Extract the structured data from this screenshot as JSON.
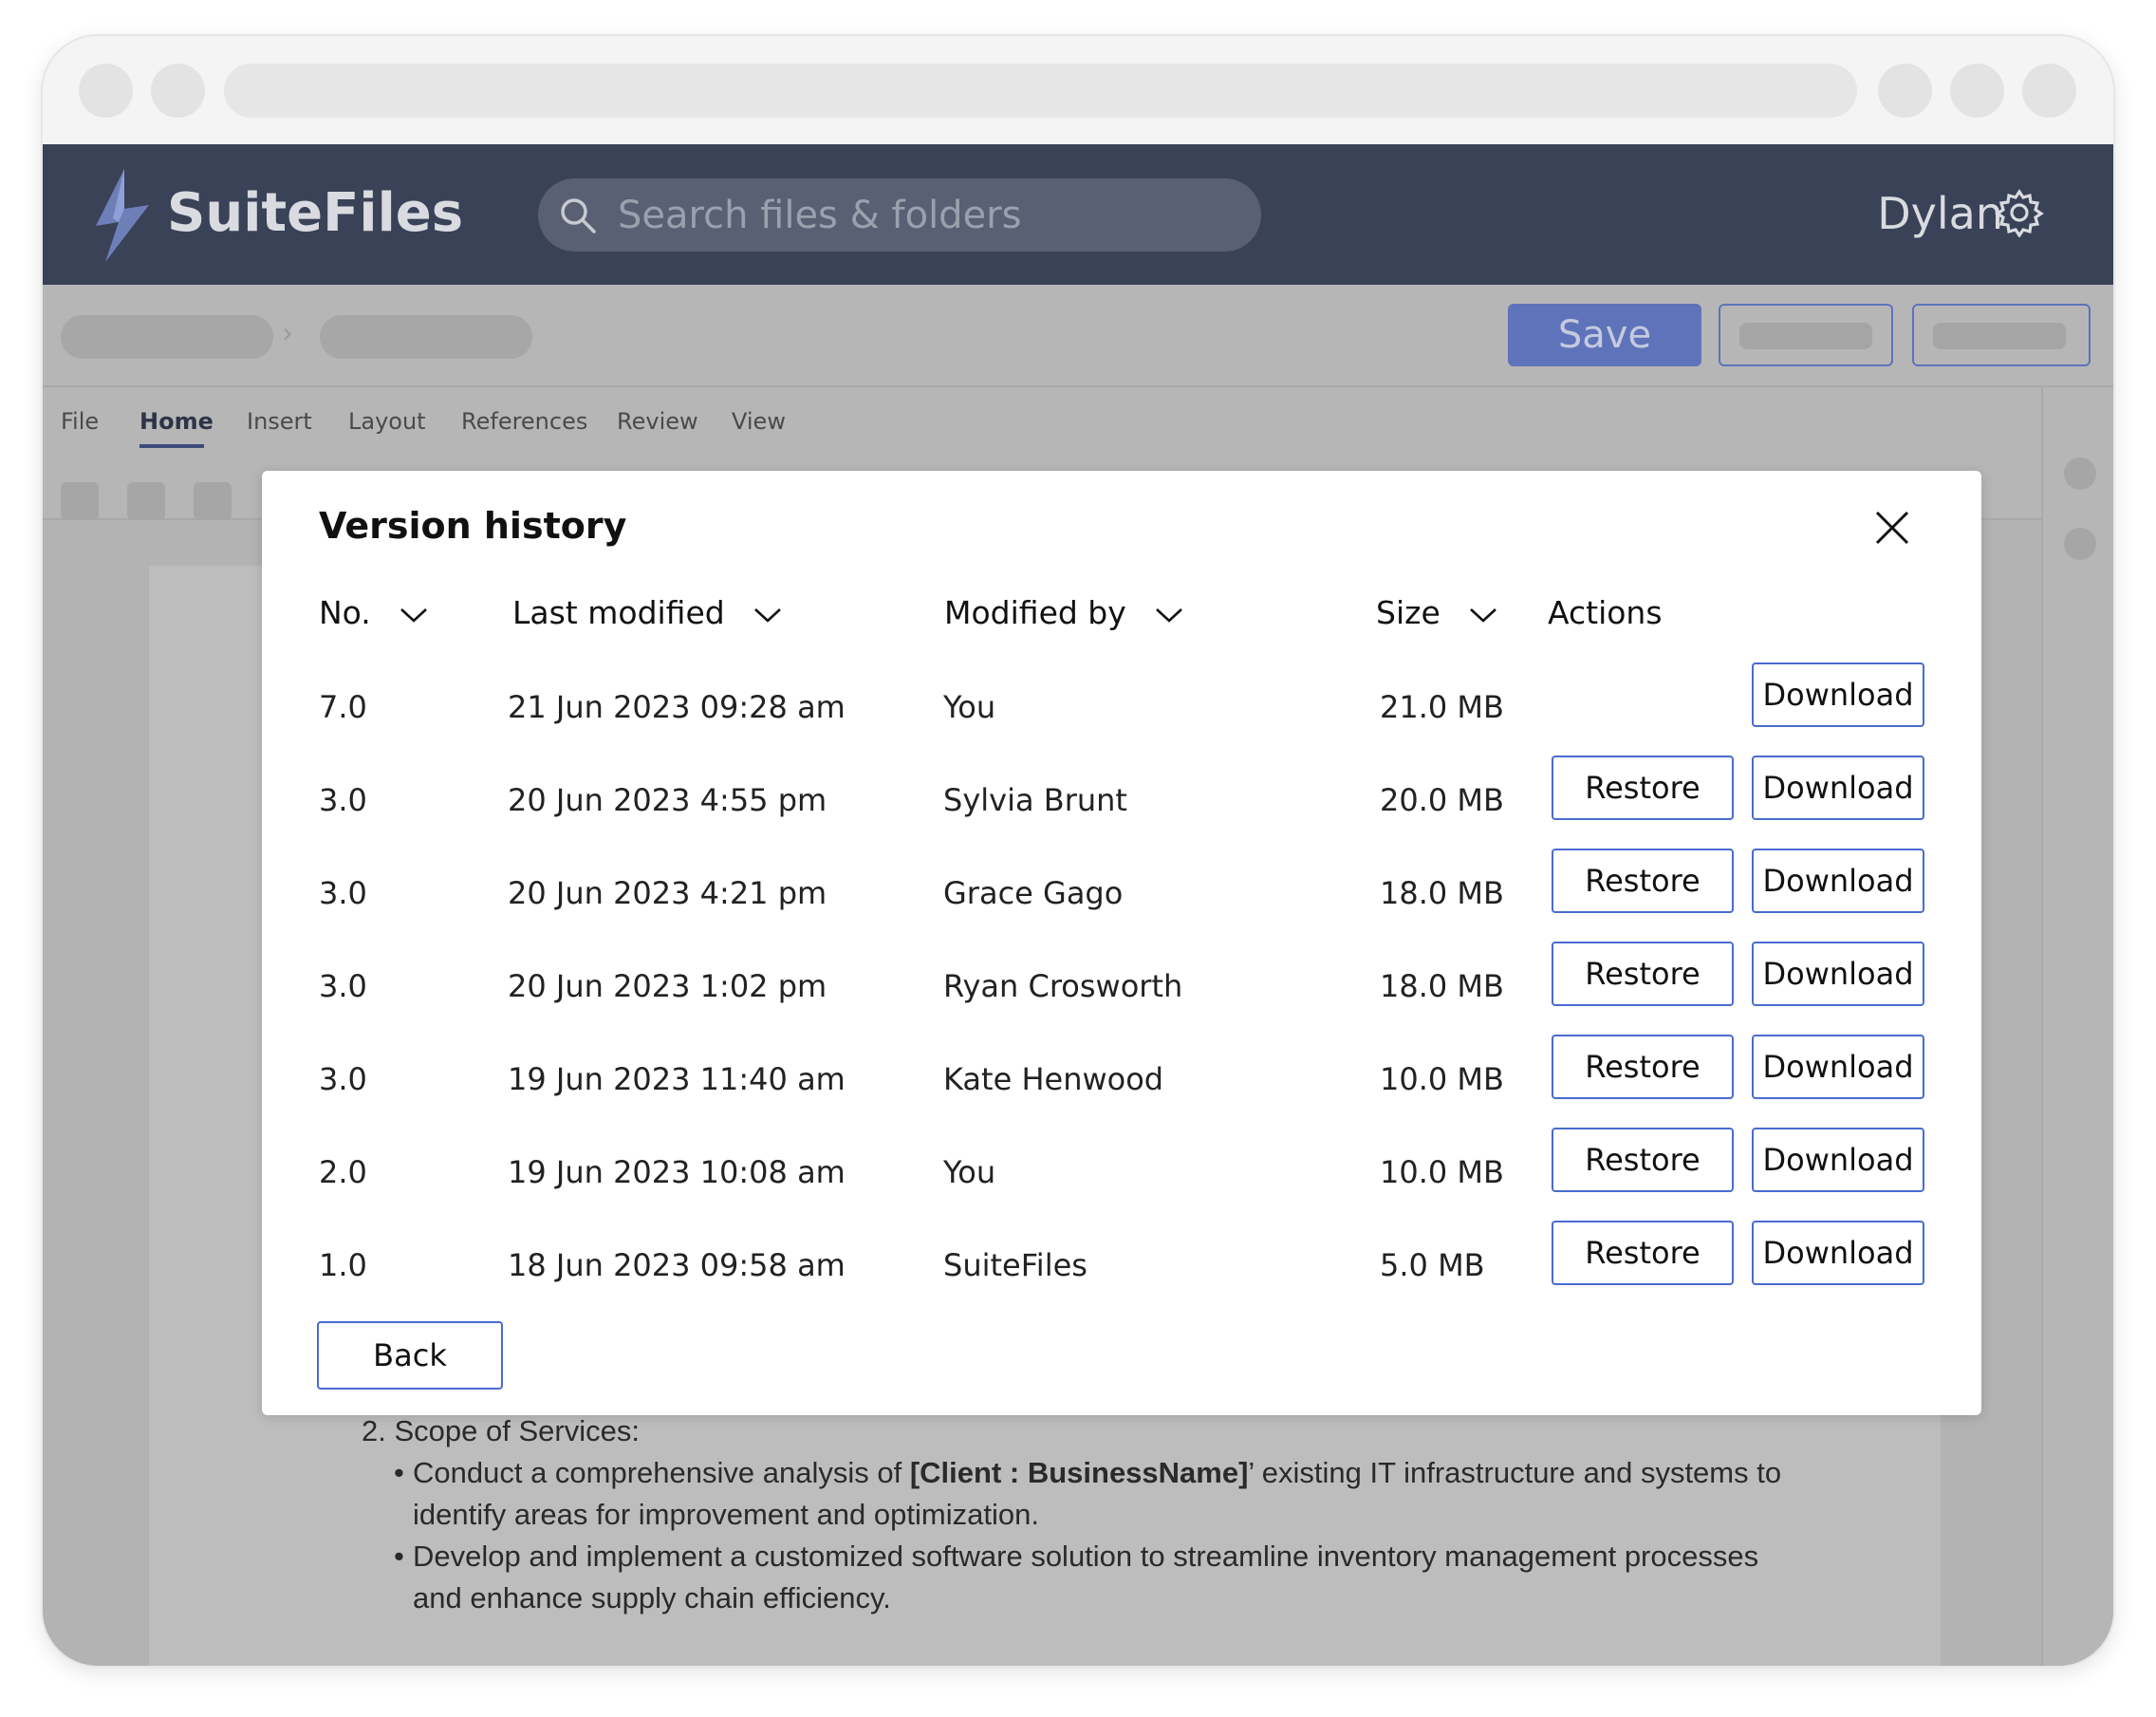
{
  "app": {
    "brand": "SuiteFiles",
    "search_placeholder": "Search files & folders",
    "user_name": "Dylan"
  },
  "toolbar": {
    "save_label": "Save"
  },
  "ribbon": {
    "tabs": [
      "File",
      "Home",
      "Insert",
      "Layout",
      "References",
      "Review",
      "View"
    ],
    "active_tab": "Home"
  },
  "document": {
    "section_number": "2.",
    "section_title": "Scope of Services:",
    "bullets": [
      {
        "before": "Conduct a comprehensive analysis of ",
        "bold": "[Client : BusinessName]",
        "after": "’ existing IT infrastructure and systems to identify areas for improvement and optimization."
      },
      {
        "before": "Develop and implement a customized software solution to streamline inventory management processes and enhance supply chain efficiency.",
        "bold": "",
        "after": ""
      }
    ]
  },
  "modal": {
    "title": "Version history",
    "columns": {
      "no": "No.",
      "last_modified": "Last modified",
      "modified_by": "Modified by",
      "size": "Size",
      "actions": "Actions"
    },
    "rows": [
      {
        "no": "7.0",
        "modified": "21 Jun 2023 09:28 am",
        "by": "You",
        "size": "21.0 MB",
        "can_restore": false
      },
      {
        "no": "3.0",
        "modified": "20 Jun 2023 4:55 pm",
        "by": "Sylvia Brunt",
        "size": "20.0 MB",
        "can_restore": true
      },
      {
        "no": "3.0",
        "modified": "20 Jun 2023 4:21 pm",
        "by": "Grace Gago",
        "size": "18.0 MB",
        "can_restore": true
      },
      {
        "no": "3.0",
        "modified": "20 Jun 2023 1:02 pm",
        "by": "Ryan Crosworth",
        "size": "18.0 MB",
        "can_restore": true
      },
      {
        "no": "3.0",
        "modified": "19 Jun 2023 11:40 am",
        "by": "Kate Henwood",
        "size": "10.0 MB",
        "can_restore": true
      },
      {
        "no": "2.0",
        "modified": "19 Jun 2023 10:08 am",
        "by": "You",
        "size": "10.0 MB",
        "can_restore": true
      },
      {
        "no": "1.0",
        "modified": "18 Jun 2023 09:58 am",
        "by": "SuiteFiles",
        "size": "5.0 MB",
        "can_restore": true
      }
    ],
    "restore_label": "Restore",
    "download_label": "Download",
    "back_label": "Back"
  },
  "colors": {
    "header_bg": "#394257",
    "accent": "#4a6bd1",
    "save_bg": "#5e73b9"
  }
}
